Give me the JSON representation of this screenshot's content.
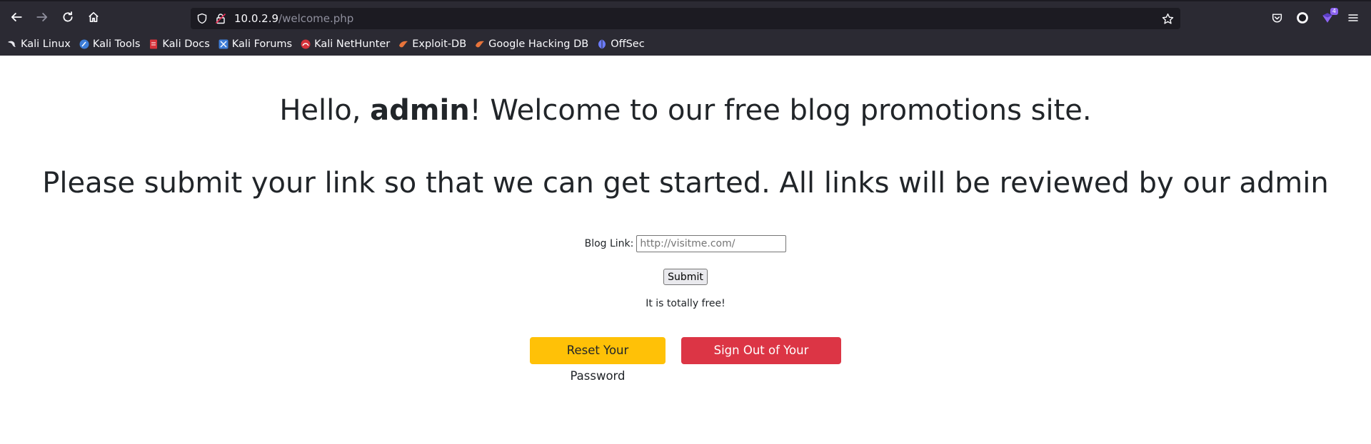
{
  "browser": {
    "url_host": "10.0.2.9",
    "url_path": "/welcome.php",
    "extension_badge": "4",
    "bookmarks": [
      {
        "label": "Kali Linux",
        "icon": "kali-dragon-icon",
        "color": "#e8e8ee"
      },
      {
        "label": "Kali Tools",
        "icon": "kali-tools-icon",
        "color": "#3d7dd8"
      },
      {
        "label": "Kali Docs",
        "icon": "kali-docs-icon",
        "color": "#d6333b"
      },
      {
        "label": "Kali Forums",
        "icon": "kali-forums-icon",
        "color": "#3d7dd8"
      },
      {
        "label": "Kali NetHunter",
        "icon": "kali-nethunter-icon",
        "color": "#d6333b"
      },
      {
        "label": "Exploit-DB",
        "icon": "exploit-db-icon",
        "color": "#e8743b"
      },
      {
        "label": "Google Hacking DB",
        "icon": "ghdb-icon",
        "color": "#e8743b"
      },
      {
        "label": "OffSec",
        "icon": "offsec-icon",
        "color": "#6b7cff"
      }
    ]
  },
  "page": {
    "greeting_prefix": "Hello, ",
    "username": "admin",
    "greeting_suffix": "! Welcome to our free blog promotions site.",
    "instructions": "Please submit your link so that we can get started. All links will be reviewed by our admin",
    "blog_link_label": "Blog Link:",
    "blog_link_placeholder": "http://visitme.com/",
    "blog_link_value": "",
    "submit_label": "Submit",
    "free_note": "It is totally free!",
    "reset_password_label": "Reset Your Password",
    "sign_out_label": "Sign Out of Your Account"
  },
  "colors": {
    "warning": "#ffc107",
    "danger": "#dc3545",
    "text": "#212529",
    "chrome_bg": "#2b2a33"
  }
}
